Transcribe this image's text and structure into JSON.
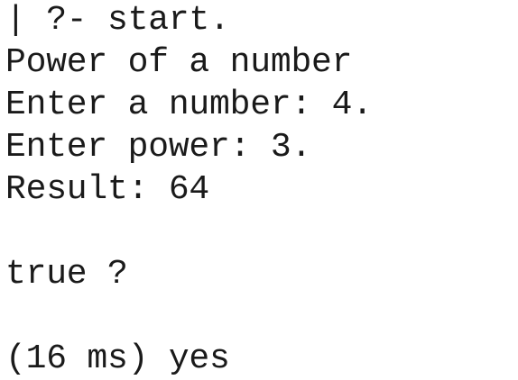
{
  "terminal": {
    "lines": [
      "| ?- start.",
      "Power of a number",
      "Enter a number: 4.",
      "Enter power: 3.",
      "Result: 64",
      "",
      "true ?",
      "",
      "(16 ms) yes"
    ]
  }
}
